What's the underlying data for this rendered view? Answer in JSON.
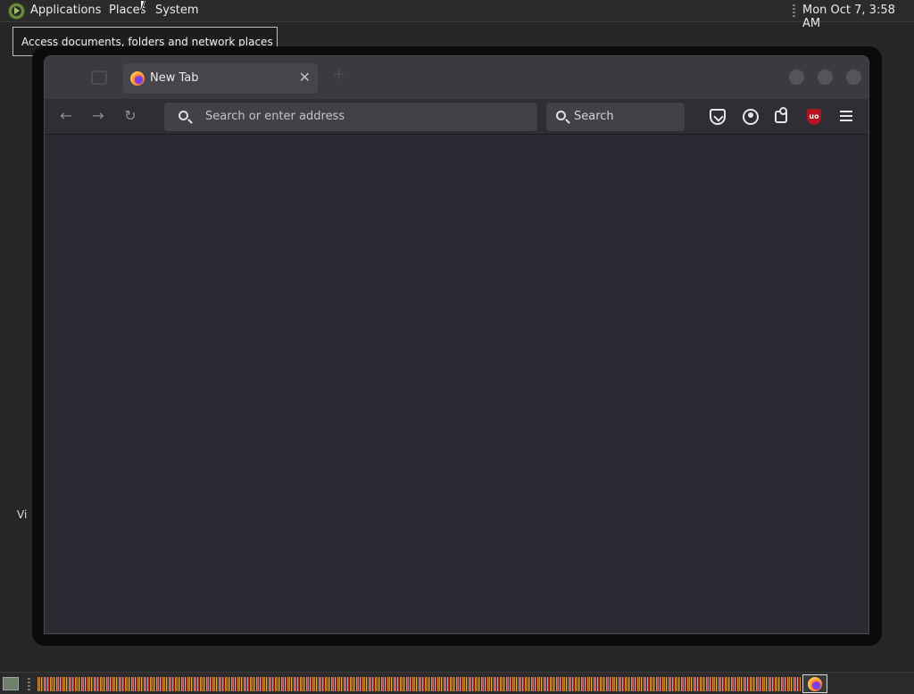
{
  "top_panel": {
    "menus": [
      "Applications",
      "Places",
      "System"
    ],
    "clock": "Mon Oct  7,  3:58 AM"
  },
  "tooltip": {
    "text": "Access documents, folders and network places"
  },
  "desktop": {
    "stray_text": "Vi"
  },
  "browser": {
    "tab": {
      "title": "New Tab",
      "close_glyph": "✕"
    },
    "nav": {
      "back_glyph": "←",
      "forward_glyph": "→",
      "reload_glyph": "↻"
    },
    "urlbar": {
      "placeholder": "Search or enter address"
    },
    "searchbar": {
      "placeholder": "Search"
    },
    "toolbar_icons": [
      "pocket-icon",
      "account-icon",
      "extensions-icon",
      "ublock-origin-icon",
      "hamburger-menu-icon"
    ],
    "ublock_badge": "uo"
  },
  "colors": {
    "panel_bg": "#2b2b2b",
    "desktop_bg": "#262626",
    "browser_content_bg": "#2b2a33",
    "ublock_red": "#b3141f"
  }
}
